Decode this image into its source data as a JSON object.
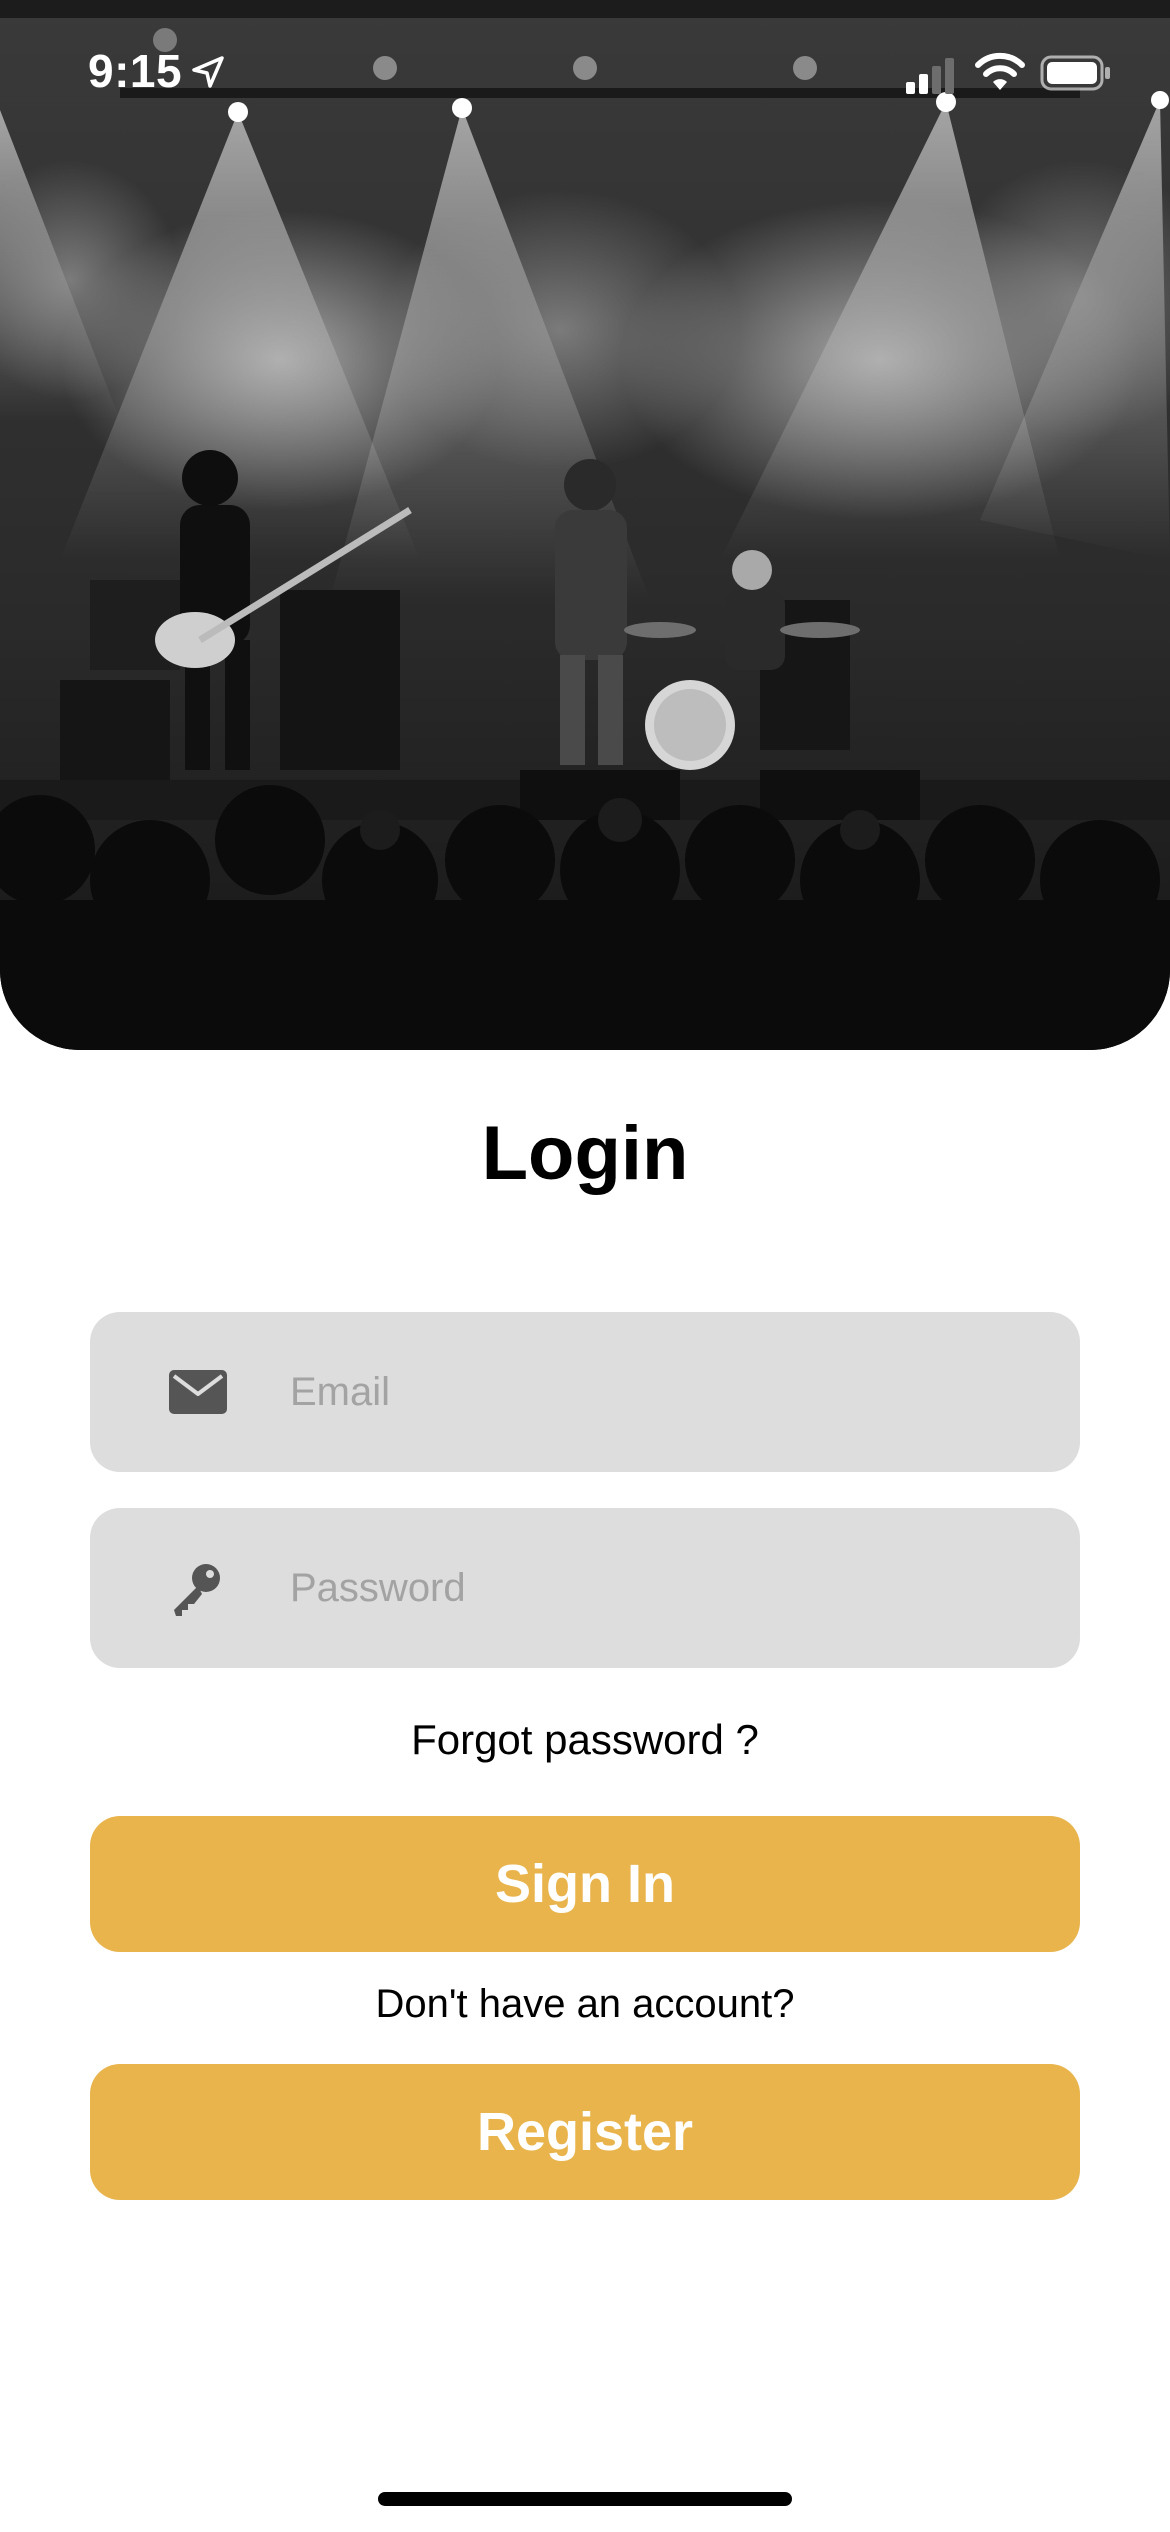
{
  "status_bar": {
    "time": "9:15"
  },
  "hero": {
    "image_description_icon": "concert-stage-photo"
  },
  "login": {
    "title": "Login",
    "email_placeholder": "Email",
    "email_value": "",
    "email_icon": "envelope-icon",
    "password_placeholder": "Password",
    "password_value": "",
    "password_icon": "key-icon",
    "forgot_label": "Forgot password ?",
    "signin_label": "Sign In",
    "no_account_label": "Don't have an account?",
    "register_label": "Register"
  },
  "colors": {
    "accent": "#e9b44c",
    "field_background": "#dddddd",
    "placeholder": "#a3a3a3",
    "text": "#000000"
  }
}
